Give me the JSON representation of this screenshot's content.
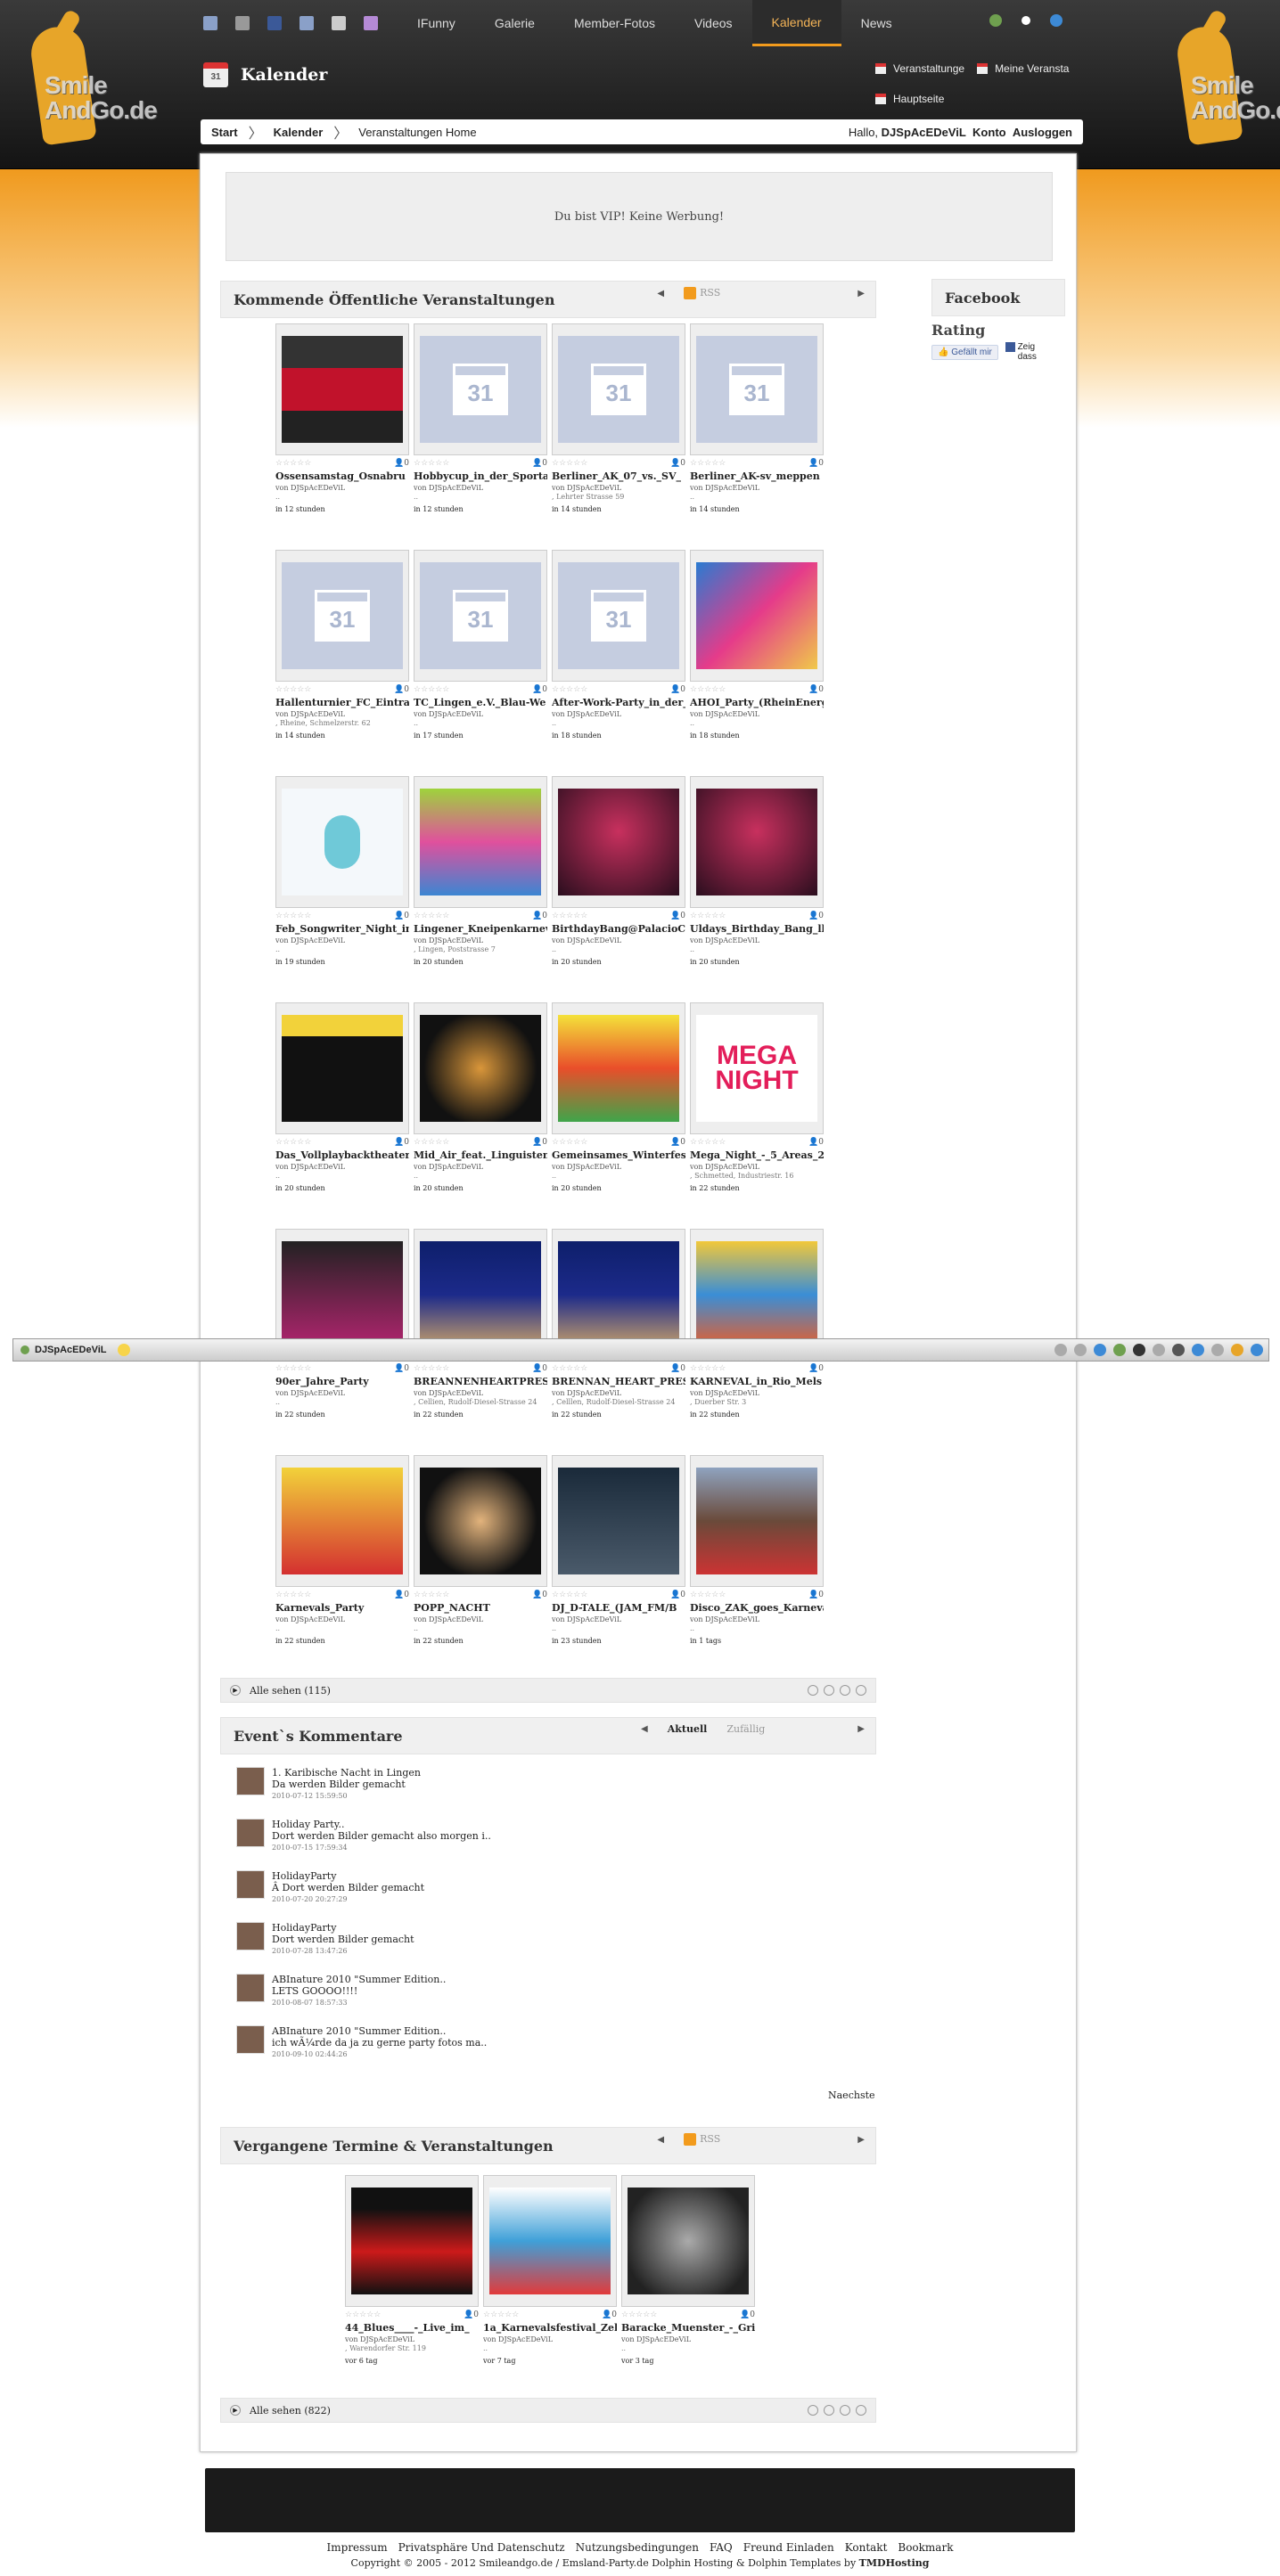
{
  "nav": {
    "items": [
      "IFunny",
      "Galerie",
      "Member-Fotos",
      "Videos",
      "Kalender",
      "News"
    ],
    "active": "Kalender"
  },
  "logo": {
    "text": "Smile AndGo.de"
  },
  "page": {
    "title": "Kalender"
  },
  "header_links": [
    "Veranstaltunge",
    "Meine Veransta",
    "Hauptseite"
  ],
  "breadcrumb": {
    "start": "Start",
    "kalender": "Kalender",
    "current": "Veranstaltungen Home",
    "greeting": "Hallo, ",
    "username": "DJSpAcEDeViL",
    "konto": "Konto",
    "logout": "Ausloggen"
  },
  "ad_text": "Du bist VIP! Keine Werbung!",
  "upcoming": {
    "title": "Kommende Öffentliche Veranstaltungen",
    "rss": "RSS",
    "view_all": "Alle sehen (115)"
  },
  "events": [
    {
      "title": "Ossensamstag_Osnabru",
      "by": "von DJSpAcEDeViL",
      "loc": "..",
      "time": "in 12 stunden",
      "img": "osna"
    },
    {
      "title": "Hobbycup_in_der_Sporta",
      "by": "von DJSpAcEDeViL",
      "loc": "..",
      "time": "in 12 stunden",
      "img": "cal"
    },
    {
      "title": "Berliner_AK_07_vs._SV_",
      "by": "von DJSpAcEDeViL",
      "loc": ", Lehrter Strasse 59",
      "time": "in 14 stunden",
      "img": "cal"
    },
    {
      "title": "Berliner_AK-sv_meppen",
      "by": "von DJSpAcEDeViL",
      "loc": "..",
      "time": "in 14 stunden",
      "img": "cal"
    },
    {
      "title": "Hallenturnier_FC_Eintrac",
      "by": "von DJSpAcEDeViL",
      "loc": ", Rheine, Schmelzerstr. 62",
      "time": "in 14 stunden",
      "img": "cal"
    },
    {
      "title": "TC_Lingen_e.V._Blau-We",
      "by": "von DJSpAcEDeViL",
      "loc": "..",
      "time": "in 17 stunden",
      "img": "cal"
    },
    {
      "title": "After-Work-Party_in_der_",
      "by": "von DJSpAcEDeViL",
      "loc": "..",
      "time": "in 18 stunden",
      "img": "cal"
    },
    {
      "title": "AHOI_Party_(RheinEnerg",
      "by": "von DJSpAcEDeViL",
      "loc": "..",
      "time": "in 18 stunden",
      "img": "ahoi"
    },
    {
      "title": "Feb_Songwriter_Night_in",
      "by": "von DJSpAcEDeViL",
      "loc": "..",
      "time": "in 19 stunden",
      "img": "song"
    },
    {
      "title": "Lingener_Kneipenkarneva",
      "by": "von DJSpAcEDeViL",
      "loc": ", Lingen, Poststrasse 7",
      "time": "in 20 stunden",
      "img": "kneipe"
    },
    {
      "title": "BirthdayBang@PalacioClu",
      "by": "von DJSpAcEDeViL",
      "loc": "..",
      "time": "in 20 stunden",
      "img": "bang"
    },
    {
      "title": "Uldays_Birthday_Bang_ll",
      "by": "von DJSpAcEDeViL",
      "loc": "..",
      "time": "in 20 stunden",
      "img": "bang"
    },
    {
      "title": "Das_Vollplaybacktheater_",
      "by": "von DJSpAcEDeViL",
      "loc": "..",
      "time": "in 20 stunden",
      "img": "voll"
    },
    {
      "title": "Mid_Air_feat._Linguisten",
      "by": "von DJSpAcEDeViL",
      "loc": "..",
      "time": "in 20 stunden",
      "img": "midair"
    },
    {
      "title": "Gemeinsames_Winterfest",
      "by": "von DJSpAcEDeViL",
      "loc": "..",
      "time": "in 20 stunden",
      "img": "winter"
    },
    {
      "title": "Mega_Night_-_5_Areas_2",
      "by": "von DJSpAcEDeViL",
      "loc": ", Schmetted, Industriestr. 16",
      "time": "in 22 stunden",
      "img": "mega"
    },
    {
      "title": "90er_Jahre_Party",
      "by": "von DJSpAcEDeViL",
      "loc": "..",
      "time": "in 22 stunden",
      "img": "90er"
    },
    {
      "title": "BREANNENHEARTPRESI",
      "by": "von DJSpAcEDeViL",
      "loc": ", Cellien, Rudolf-Diesel-Strasse 24",
      "time": "in 22 stunden",
      "img": "city"
    },
    {
      "title": "BRENNAN_HEART_PRES",
      "by": "von DJSpAcEDeViL",
      "loc": ", Celllen, Rudolf-Diesel-Strasse 24",
      "time": "in 22 stunden",
      "img": "city"
    },
    {
      "title": "KARNEVAL_in_Rio_Mels",
      "by": "von DJSpAcEDeViL",
      "loc": ", Duerber Str. 3",
      "time": "in 22 stunden",
      "img": "rio"
    },
    {
      "title": "Karnevals_Party",
      "by": "von DJSpAcEDeViL",
      "loc": "..",
      "time": "in 22 stunden",
      "img": "karn"
    },
    {
      "title": "POPP_NACHT",
      "by": "von DJSpAcEDeViL",
      "loc": "..",
      "time": "in 22 stunden",
      "img": "popp"
    },
    {
      "title": "DJ_D-TALE_(JAM_FM/B",
      "by": "von DJSpAcEDeViL",
      "loc": "..",
      "time": "in 23 stunden",
      "img": "dtale"
    },
    {
      "title": "Disco_ZAK_goes_Karneva",
      "by": "von DJSpAcEDeViL",
      "loc": "..",
      "time": "in 1 tags",
      "img": "zak"
    }
  ],
  "facebook": {
    "title": "Facebook",
    "rating": "Rating",
    "like": "Gefällt mir",
    "zeig": "Zeig",
    "dass": "dass"
  },
  "comments_section": {
    "title": "Event`s Kommentare",
    "tab_active": "Aktuell",
    "tab_random": "Zufällig",
    "next": "Naechste"
  },
  "comments": [
    {
      "title": "1. Karibische Nacht in Lingen",
      "text": "Da werden Bilder gemacht",
      "date": "2010-07-12 15:59:50"
    },
    {
      "title": "Holiday Party..",
      "text": "Dort werden Bilder gemacht also morgen i..",
      "date": "2010-07-15 17:59:34"
    },
    {
      "title": "HolidayParty",
      "text": "Â Dort werden Bilder gemacht",
      "date": "2010-07-20 20:27:29"
    },
    {
      "title": "HolidayParty",
      "text": "Dort werden Bilder gemacht",
      "date": "2010-07-28 13:47:26"
    },
    {
      "title": "ABInature 2010 \"Summer Edition..",
      "text": "LETS GOOOO!!!!",
      "date": "2010-08-07 18:57:33"
    },
    {
      "title": "ABInature 2010 \"Summer Edition..",
      "text": "ich wÃ¼rde da ja zu gerne party fotos ma..",
      "date": "2010-09-10 02:44:26"
    }
  ],
  "past": {
    "title": "Vergangene Termine & Veranstaltungen",
    "rss": "RSS",
    "view_all": "Alle sehen (822)"
  },
  "past_events": [
    {
      "title": "44_Blues____-_Live_im_",
      "by": "von DJSpAcEDeViL",
      "loc": ", Warendorfer Str. 119",
      "time": "vor 6 tag",
      "img": "blues"
    },
    {
      "title": "1a_Karnevalsfestival_Zel",
      "by": "von DJSpAcEDeViL",
      "loc": "..",
      "time": "vor 7 tag",
      "img": "karnfest"
    },
    {
      "title": "Baracke_Muenster_-_Gri",
      "by": "von DJSpAcEDeViL",
      "loc": "..",
      "time": "vor 3 tag",
      "img": "baracke"
    }
  ],
  "bottombar": {
    "username": "DJSpAcEDeViL"
  },
  "footer": {
    "links": [
      "Impressum",
      "Privatsphäre Und Datenschutz",
      "Nutzungsbedingungen",
      "FAQ",
      "Freund Einladen",
      "Kontakt",
      "Bookmark"
    ],
    "copyright": "Copyright © 2005 - 2012 Smileandgo.de / Emsland-Party.de  Dolphin Hosting & Dolphin Templates by ",
    "tmd": "TMDHosting"
  },
  "colors": {
    "accent": "#f29b1d",
    "dark": "#1f1f1f"
  }
}
